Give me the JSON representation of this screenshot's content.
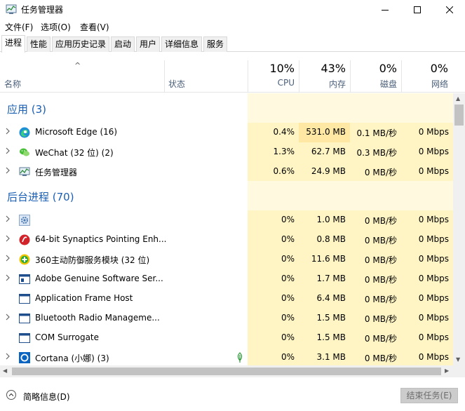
{
  "window": {
    "title": "任务管理器"
  },
  "menu": {
    "file": "文件(F)",
    "options": "选项(O)",
    "view": "查看(V)"
  },
  "tabs": [
    "进程",
    "性能",
    "应用历史记录",
    "启动",
    "用户",
    "详细信息",
    "服务"
  ],
  "active_tab": "进程",
  "columns": {
    "name": "名称",
    "status": "状态",
    "cpu": {
      "percent": "10%",
      "label": "CPU"
    },
    "memory": {
      "percent": "43%",
      "label": "内存"
    },
    "disk": {
      "percent": "0%",
      "label": "磁盘"
    },
    "network": {
      "percent": "0%",
      "label": "网络"
    }
  },
  "groups": {
    "apps": {
      "title": "应用 (3)",
      "rows": [
        {
          "name": "Microsoft Edge (16)",
          "icon": "edge-icon",
          "cpu": "0.4%",
          "memory": "531.0 MB",
          "disk": "0.1 MB/秒",
          "network": "0 Mbps"
        },
        {
          "name": "WeChat (32 位) (2)",
          "icon": "wechat-icon",
          "cpu": "1.3%",
          "memory": "62.7 MB",
          "disk": "0.3 MB/秒",
          "network": "0 Mbps"
        },
        {
          "name": "任务管理器",
          "icon": "task-manager-icon",
          "cpu": "0.6%",
          "memory": "24.9 MB",
          "disk": "0 MB/秒",
          "network": "0 Mbps"
        }
      ]
    },
    "background": {
      "title": "后台进程 (70)",
      "rows": [
        {
          "name": "",
          "icon": "gear-icon",
          "cpu": "0%",
          "memory": "1.0 MB",
          "disk": "0 MB/秒",
          "network": "0 Mbps"
        },
        {
          "name": "64-bit Synaptics Pointing Enh...",
          "icon": "synaptics-icon",
          "cpu": "0%",
          "memory": "0.8 MB",
          "disk": "0 MB/秒",
          "network": "0 Mbps"
        },
        {
          "name": "360主动防御服务模块 (32 位)",
          "icon": "360-icon",
          "cpu": "0%",
          "memory": "11.6 MB",
          "disk": "0 MB/秒",
          "network": "0 Mbps"
        },
        {
          "name": "Adobe Genuine Software Ser...",
          "icon": "service-window-icon",
          "cpu": "0%",
          "memory": "1.7 MB",
          "disk": "0 MB/秒",
          "network": "0 Mbps"
        },
        {
          "name": "Application Frame Host",
          "icon": "window-icon",
          "cpu": "0%",
          "memory": "6.4 MB",
          "disk": "0 MB/秒",
          "network": "0 Mbps"
        },
        {
          "name": "Bluetooth Radio Manageme...",
          "icon": "window-icon",
          "cpu": "0%",
          "memory": "1.5 MB",
          "disk": "0 MB/秒",
          "network": "0 Mbps"
        },
        {
          "name": "COM Surrogate",
          "icon": "window-icon",
          "cpu": "0%",
          "memory": "1.5 MB",
          "disk": "0 MB/秒",
          "network": "0 Mbps"
        },
        {
          "name": "Cortana (小娜) (3)",
          "icon": "cortana-icon",
          "cpu": "0%",
          "memory": "3.1 MB",
          "disk": "0 MB/秒",
          "network": "0 Mbps"
        }
      ]
    }
  },
  "footer": {
    "fewer_details": "简略信息(D)",
    "end_task": "结束任务(E)"
  },
  "colors": {
    "heat_light": "#fff9e0",
    "heat_mid": "#fff4c4",
    "heat_strong": "#ffe8a4",
    "group_title": "#1a5fb4"
  }
}
